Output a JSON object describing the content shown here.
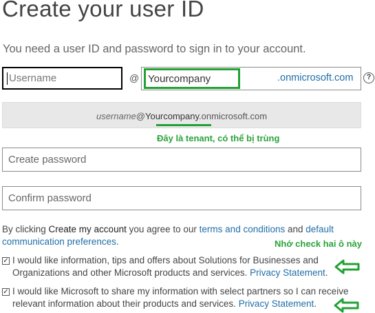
{
  "page": {
    "title": "Create your user ID",
    "subtitle": "You need a user ID and password to sign in to your account."
  },
  "form": {
    "username_placeholder": "Username",
    "at_symbol": "@",
    "tenant_value": "Yourcompany",
    "domain_suffix": ".onmicrosoft.com",
    "help_symbol": "?",
    "preview": {
      "username": "username",
      "at": "@",
      "tenant": "Yourcompany",
      "suffix": ".onmicrosoft.com"
    },
    "create_password_placeholder": "Create password",
    "confirm_password_placeholder": "Confirm password"
  },
  "consent": {
    "prefix": "By clicking ",
    "button_name": "Create my account",
    "middle": " you agree to our ",
    "terms_link": "terms and conditions",
    "and": " and ",
    "prefs_link": "default communication preferences",
    "end": "."
  },
  "options": {
    "offers_text": "I would like information, tips and offers about Solutions for Businesses and Organizations and other Microsoft products and services. ",
    "offers_checked": true,
    "partners_text": "I would like Microsoft to share my information with select partners so I can receive relevant information about their products and services. ",
    "partners_checked": true,
    "privacy_link": "Privacy Statement",
    "period": "."
  },
  "annotations": {
    "tenant_note": "Đây là tenant, có thể bị trùng",
    "check_note": "Nhớ check hai ô này",
    "color": "#22a133"
  },
  "colors": {
    "link": "#1f6ea8",
    "annotation_green": "#22a133",
    "preview_bg": "#e8e8e8"
  }
}
